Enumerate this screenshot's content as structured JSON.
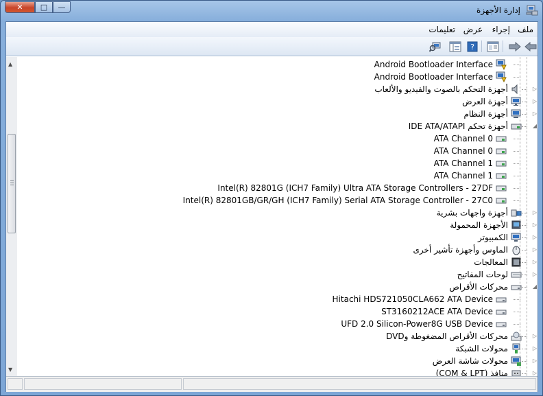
{
  "window": {
    "title": "إدارة الأجهزة",
    "title_icon": "device-manager-icon",
    "buttons": {
      "close": "✕",
      "maximize": "□",
      "minimize": "—"
    }
  },
  "menu": {
    "file": "ملف",
    "action": "إجراء",
    "view": "عرض",
    "help": "تعليمات"
  },
  "toolbar": {
    "icons": [
      "back-arrow-icon",
      "forward-arrow-icon",
      "properties-icon",
      "help-icon",
      "console-tree-icon",
      "scan-hardware-icon"
    ]
  },
  "tree": {
    "items": [
      {
        "label": "Android Bootloader Interface",
        "level": 1,
        "icon": "android-device-warning-icon",
        "expander": ""
      },
      {
        "label": "Android Bootloader Interface",
        "level": 1,
        "icon": "android-device-warning-icon",
        "expander": ""
      },
      {
        "label": "أجهزة التحكم بالصوت والفيديو والألعاب",
        "level": 0,
        "icon": "speaker-icon",
        "expander": "▷"
      },
      {
        "label": "أجهزة العرض",
        "level": 0,
        "icon": "monitor-icon",
        "expander": "▷"
      },
      {
        "label": "أجهزة النظام",
        "level": 0,
        "icon": "system-devices-icon",
        "expander": "▷"
      },
      {
        "label": "أجهزة تحكم IDE ATA/ATAPI",
        "level": 0,
        "icon": "ide-controller-icon",
        "expander": "◢"
      },
      {
        "label": "ATA Channel 0",
        "level": 1,
        "icon": "ide-channel-icon",
        "expander": ""
      },
      {
        "label": "ATA Channel 0",
        "level": 1,
        "icon": "ide-channel-icon",
        "expander": ""
      },
      {
        "label": "ATA Channel 1",
        "level": 1,
        "icon": "ide-channel-icon",
        "expander": ""
      },
      {
        "label": "ATA Channel 1",
        "level": 1,
        "icon": "ide-channel-icon",
        "expander": ""
      },
      {
        "label": "Intel(R) 82801G (ICH7 Family) Ultra ATA Storage Controllers - 27DF",
        "level": 1,
        "icon": "ide-channel-icon",
        "expander": ""
      },
      {
        "label": "Intel(R) 82801GB/GR/GH (ICH7 Family) Serial ATA Storage Controller - 27C0",
        "level": 1,
        "icon": "ide-channel-icon",
        "expander": ""
      },
      {
        "label": "أجهزة واجهات بشرية",
        "level": 0,
        "icon": "hid-icon",
        "expander": "▷"
      },
      {
        "label": "الأجهزة المحمولة",
        "level": 0,
        "icon": "portable-device-icon",
        "expander": "▷"
      },
      {
        "label": "الكمبيوتر",
        "level": 0,
        "icon": "computer-icon",
        "expander": "▷"
      },
      {
        "label": "الماوس وأجهزة تأشير أخرى",
        "level": 0,
        "icon": "mouse-icon",
        "expander": "▷"
      },
      {
        "label": "المعالجات",
        "level": 0,
        "icon": "processor-icon",
        "expander": "▷"
      },
      {
        "label": "لوحات المفاتيح",
        "level": 0,
        "icon": "keyboard-icon",
        "expander": "▷"
      },
      {
        "label": "محركات الأقراص",
        "level": 0,
        "icon": "disk-drive-icon",
        "expander": "◢"
      },
      {
        "label": "Hitachi HDS721050CLA662 ATA Device",
        "level": 1,
        "icon": "hard-disk-icon",
        "expander": ""
      },
      {
        "label": "ST3160212ACE ATA Device",
        "level": 1,
        "icon": "hard-disk-icon",
        "expander": ""
      },
      {
        "label": "UFD 2.0 Silicon-Power8G USB Device",
        "level": 1,
        "icon": "hard-disk-icon",
        "expander": ""
      },
      {
        "label": "محركات الأقراص المضغوطة وDVD",
        "level": 0,
        "icon": "dvd-drive-icon",
        "expander": "▷"
      },
      {
        "label": "محولات الشبكة",
        "level": 0,
        "icon": "network-adapter-icon",
        "expander": "▷"
      },
      {
        "label": "محولات شاشة العرض",
        "level": 0,
        "icon": "display-adapter-icon",
        "expander": "▷"
      },
      {
        "label": "منافذ (COM & LPT)",
        "level": 0,
        "icon": "port-icon",
        "expander": "▷"
      }
    ]
  },
  "scrollbar": {
    "up": "▲",
    "down": "▼"
  }
}
